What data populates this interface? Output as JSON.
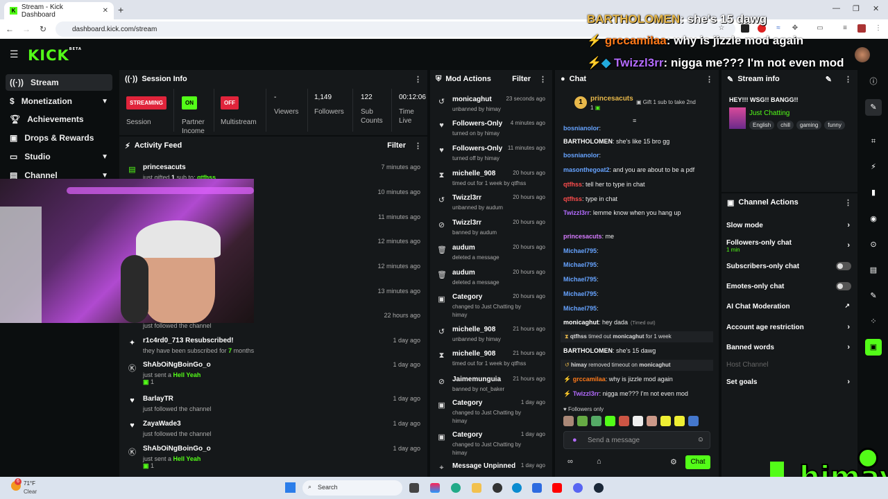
{
  "browser": {
    "tab_title": "Stream - Kick Dashboard",
    "url": "dashboard.kick.com/stream"
  },
  "overlay_chat": [
    {
      "user": "BARTHOLOMEN",
      "text": ": she's 15 dawg",
      "color": "#e8b84a"
    },
    {
      "user": "grccamilaa",
      "text": ": why is jizzle mod again",
      "color": "#ff7a1a"
    },
    {
      "user": "Twizzl3rr",
      "text": ": nigga me??? I'm not even mod",
      "color": "#b36bff"
    }
  ],
  "logo": {
    "text": "KICK",
    "beta": "BETA"
  },
  "sidebar": {
    "items": [
      {
        "label": "Stream",
        "icon": "broadcast-icon"
      },
      {
        "label": "Monetization",
        "icon": "dollar-icon"
      },
      {
        "label": "Achievements",
        "icon": "trophy-icon"
      },
      {
        "label": "Drops & Rewards",
        "icon": "gift-icon"
      },
      {
        "label": "Studio",
        "icon": "monitor-icon"
      },
      {
        "label": "Channel",
        "icon": "channel-icon"
      }
    ]
  },
  "session": {
    "title": "Session Info",
    "streaming_badge": "STREAMING",
    "session_label": "Session",
    "partner_badge": "ON",
    "partner_label": "Partner\nIncome",
    "multistream_badge": "OFF",
    "multistream_label": "Multistream",
    "viewers_value": "-",
    "viewers_label": "Viewers",
    "followers_value": "1,149",
    "followers_label": "Followers",
    "subs_value": "122",
    "subs_label": "Sub\nCounts",
    "time_value": "00:12:06",
    "time_label": "Time\nLive"
  },
  "activity": {
    "title": "Activity Feed",
    "filter": "Filter",
    "rows": [
      {
        "name": "princesacuts",
        "sub": "just gifted 1 sub to: qtfhss",
        "time": "7 minutes ago",
        "icon": "gift-icon"
      },
      {
        "name": "",
        "sub": "",
        "time": "10 minutes ago",
        "icon": ""
      },
      {
        "name": "",
        "sub": "",
        "time": "11 minutes ago",
        "icon": ""
      },
      {
        "name": "",
        "sub": "",
        "time": "12 minutes ago",
        "icon": ""
      },
      {
        "name": "",
        "sub": "",
        "time": "12 minutes ago",
        "icon": ""
      },
      {
        "name": "",
        "sub": "",
        "time": "13 minutes ago",
        "icon": ""
      },
      {
        "name": "",
        "sub": "just followed the channel",
        "time": "22 hours ago",
        "icon": ""
      },
      {
        "name": "r1c4rd0_713 Resubscribed!",
        "sub": "they have been subscribed for 7 months",
        "time": "1 day ago",
        "icon": "star-icon"
      },
      {
        "name": "ShAbOiNgBoinGo_o",
        "sub": "just sent a Hell Yeah",
        "sub2": "1",
        "time": "1 day ago",
        "icon": "kick-icon"
      },
      {
        "name": "BarlayTR",
        "sub": "just followed the channel",
        "time": "1 day ago",
        "icon": "heart-icon"
      },
      {
        "name": "ZayaWade3",
        "sub": "just followed the channel",
        "time": "1 day ago",
        "icon": "heart-icon"
      },
      {
        "name": "ShAbOiNgBoinGo_o",
        "sub": "just sent a Hell Yeah",
        "sub2": "1",
        "time": "1 day ago",
        "icon": "kick-icon"
      }
    ]
  },
  "mod": {
    "title": "Mod Actions",
    "filter": "Filter",
    "rows": [
      {
        "name": "monicaghut",
        "sub": "unbanned by himay",
        "time": "23 seconds ago",
        "icon": "undo-icon"
      },
      {
        "name": "Followers-Only",
        "sub": "turned on by himay",
        "time": "4 minutes ago",
        "icon": "heart-icon"
      },
      {
        "name": "Followers-Only",
        "sub": "turned off by himay",
        "time": "11 minutes ago",
        "icon": "heart-icon"
      },
      {
        "name": "michelle_908",
        "sub": "timed out for 1 week by qtfhss",
        "time": "20 hours ago",
        "icon": "hourglass-icon"
      },
      {
        "name": "Twizzl3rr",
        "sub": "unbanned by audum",
        "time": "20 hours ago",
        "icon": "undo-icon"
      },
      {
        "name": "Twizzl3rr",
        "sub": "banned by audum",
        "time": "20 hours ago",
        "icon": "ban-icon"
      },
      {
        "name": "audum",
        "sub": "deleted a message",
        "time": "20 hours ago",
        "icon": "trash-icon"
      },
      {
        "name": "audum",
        "sub": "deleted a message",
        "time": "20 hours ago",
        "icon": "trash-icon"
      },
      {
        "name": "Category",
        "sub": "changed to Just Chatting by himay",
        "time": "20 hours ago",
        "icon": "category-icon"
      },
      {
        "name": "michelle_908",
        "sub": "unbanned by himay",
        "time": "21 hours ago",
        "icon": "undo-icon"
      },
      {
        "name": "michelle_908",
        "sub": "timed out for 1 week by qtfhss",
        "time": "21 hours ago",
        "icon": "hourglass-icon"
      },
      {
        "name": "Jaimemunguia",
        "sub": "banned by not_baker",
        "time": "21 hours ago",
        "icon": "ban-icon"
      },
      {
        "name": "Category",
        "sub": "changed to Just Chatting by himay",
        "time": "1 day ago",
        "icon": "category-icon"
      },
      {
        "name": "Category",
        "sub": "changed to Just Chatting by himay",
        "time": "1 day ago",
        "icon": "category-icon"
      },
      {
        "name": "Message Unpinned",
        "sub": "",
        "time": "1 day ago",
        "icon": "pin-icon"
      }
    ]
  },
  "chat": {
    "title": "Chat",
    "top_gifter": "princesacuts",
    "top_gifter_count": "1",
    "gift_prompt": "Gift 1 sub to take 2nd",
    "messages": [
      {
        "user": "bosnianolor",
        "text": ":",
        "color": "#66a3ff"
      },
      {
        "user": "BARTHOLOMEN",
        "text": ": she's like 15 bro gg",
        "color": "#ffffff"
      },
      {
        "user": "bosnianolor",
        "text": ":",
        "color": "#66a3ff"
      },
      {
        "user": "masonthegoat2",
        "text": ": and you are about to be a pdf",
        "color": "#66a3ff"
      },
      {
        "user": "qtfhss",
        "text": ": tell her to type in chat",
        "color": "#ff4d4d"
      },
      {
        "user": "qtfhss",
        "text": ": type in chat",
        "color": "#ff4d4d"
      },
      {
        "user": "Twizzl3rr",
        "text": ": lemme know when you hang up",
        "color": "#b36bff"
      },
      {
        "user": "princesacuts",
        "text": ": me",
        "color": "#d67bff"
      },
      {
        "user": "Michael795",
        "text": ":",
        "color": "#66a3ff"
      },
      {
        "user": "Michael795",
        "text": ":",
        "color": "#66a3ff"
      },
      {
        "user": "Michael795",
        "text": ":",
        "color": "#66a3ff"
      },
      {
        "user": "Michael795",
        "text": ":",
        "color": "#66a3ff"
      },
      {
        "user": "Michael795",
        "text": ":",
        "color": "#66a3ff"
      },
      {
        "user": "monicaghut",
        "text": ": hey dada",
        "extra": "(Timed out)",
        "color": "#ffffff"
      }
    ],
    "sys1": {
      "user": "qtfhss",
      "text": "timed out",
      "target": "monicaghut",
      "tail": "for 1 week"
    },
    "msg_after1": {
      "user": "BARTHOLOMEN",
      "text": ": she's 15 dawg"
    },
    "sys2": {
      "user": "himay",
      "text": "removed timeout on",
      "target": "monicaghut"
    },
    "msg_after2": {
      "user": "grccamilaa",
      "text": ": why is jizzle mod again"
    },
    "msg_after3": {
      "user": "Twizzl3rr",
      "text": ": nigga me??? I'm not even mod"
    },
    "followers_only": "Followers only",
    "input_placeholder": "Send a message",
    "send_label": "Chat"
  },
  "stream_info": {
    "title": "Stream info",
    "stream_title": "HEY!!! WSG!! BANGG!!",
    "category": "Just Chatting",
    "tags": [
      "English",
      "chill",
      "gaming",
      "funny"
    ]
  },
  "channel_actions": {
    "title": "Channel Actions",
    "items": [
      {
        "label": "Slow mode",
        "kind": "chevron"
      },
      {
        "label": "Followers-only chat",
        "sub": "1 min",
        "kind": "chevron"
      },
      {
        "label": "Subscribers-only chat",
        "kind": "toggle"
      },
      {
        "label": "Emotes-only chat",
        "kind": "toggle"
      },
      {
        "label": "AI Chat Moderation",
        "kind": "external"
      },
      {
        "label": "Account age restriction",
        "kind": "chevron"
      },
      {
        "label": "Banned words",
        "kind": "chevron"
      },
      {
        "label": "Host Channel",
        "kind": "disabled"
      },
      {
        "label": "Set goals",
        "kind": "chevron"
      }
    ]
  },
  "watermark": "himay",
  "taskbar": {
    "weather_temp": "71°F",
    "weather_desc": "Clear",
    "weather_badge": "6",
    "search": "Search"
  },
  "colors": {
    "accent": "#53fc18",
    "panel": "#15181a",
    "bg": "#0b0e0f"
  }
}
